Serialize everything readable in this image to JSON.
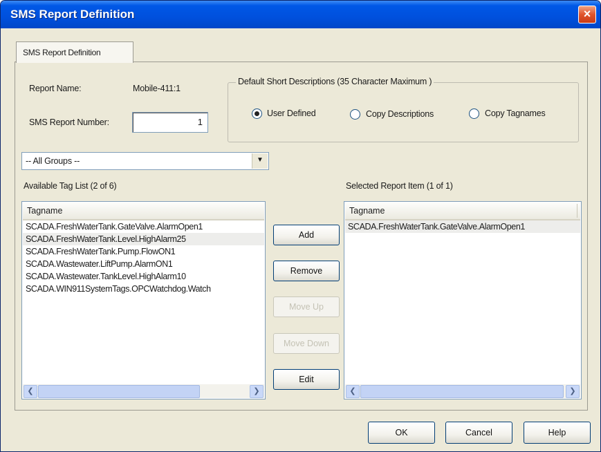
{
  "window": {
    "title": "SMS Report Definition",
    "close_glyph": "×"
  },
  "tab": {
    "label": "SMS Report Definition"
  },
  "report": {
    "name_label": "Report Name:",
    "name_value": "Mobile-411:1",
    "number_label": "SMS Report Number:",
    "number_value": "1"
  },
  "descriptions": {
    "group_title": "Default Short Descriptions  (35 Character Maximum )",
    "options": [
      {
        "label": "User Defined",
        "selected": true
      },
      {
        "label": "Copy Descriptions",
        "selected": false
      },
      {
        "label": "Copy Tagnames",
        "selected": false
      }
    ]
  },
  "groups": {
    "selected": "-- All Groups --"
  },
  "available": {
    "label": "Available Tag List (2 of 6)",
    "column": "Tagname",
    "rows": [
      "SCADA.FreshWaterTank.GateValve.AlarmOpen1",
      "SCADA.FreshWaterTank.Level.HighAlarm25",
      "SCADA.FreshWaterTank.Pump.FlowON1",
      "SCADA.Wastewater.LiftPump.AlarmON1",
      "SCADA.Wastewater.TankLevel.HighAlarm10",
      "SCADA.WIN911SystemTags.OPCWatchdog.Watch"
    ],
    "highlighted_index": 1
  },
  "selected": {
    "label": "Selected Report Item (1 of 1)",
    "column": "Tagname",
    "rows": [
      "SCADA.FreshWaterTank.GateValve.AlarmOpen1"
    ]
  },
  "buttons": {
    "add": "Add",
    "remove": "Remove",
    "move_up": "Move Up",
    "move_down": "Move Down",
    "edit": "Edit",
    "ok": "OK",
    "cancel": "Cancel",
    "help": "Help"
  },
  "icons": {
    "dropdown": "chevron-down-icon",
    "scroll_left": "chevron-left-icon",
    "scroll_right": "chevron-right-icon"
  }
}
